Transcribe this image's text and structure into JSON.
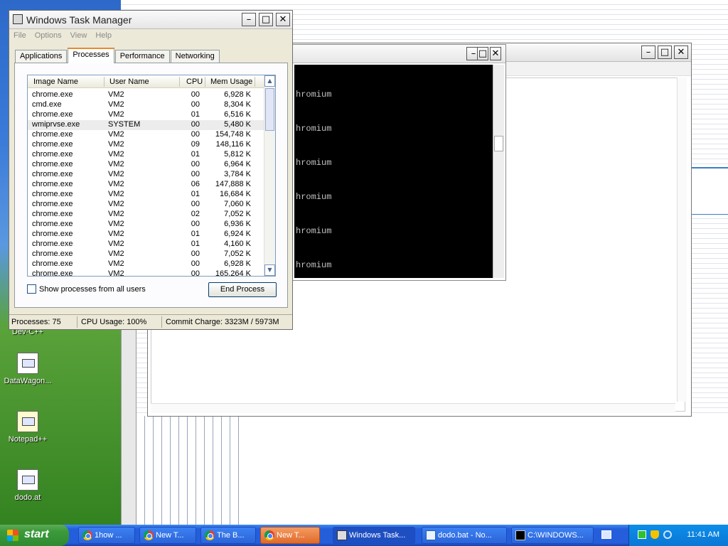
{
  "desktop": {
    "icons": [
      {
        "name": "devcpp",
        "label": "Dev-C++"
      },
      {
        "name": "datawagon",
        "label": "DataWagon..."
      },
      {
        "name": "notepadpp",
        "label": "Notepad++"
      },
      {
        "name": "dodo",
        "label": "dodo.at"
      }
    ]
  },
  "console": {
    "lines": [
      "hromium",
      "hromium",
      "hromium",
      "hromium",
      "hromium",
      "hromium"
    ]
  },
  "task_manager": {
    "title": "Windows Task Manager",
    "menu": [
      "File",
      "Options",
      "View",
      "Help"
    ],
    "tabs": [
      "Applications",
      "Processes",
      "Performance",
      "Networking"
    ],
    "active_tab": "Processes",
    "columns": [
      "Image Name",
      "User Name",
      "CPU",
      "Mem Usage"
    ],
    "rows": [
      {
        "image": "chrome.exe",
        "user": "VM2",
        "cpu": "00",
        "mem": "6,928 K"
      },
      {
        "image": "cmd.exe",
        "user": "VM2",
        "cpu": "00",
        "mem": "8,304 K"
      },
      {
        "image": "chrome.exe",
        "user": "VM2",
        "cpu": "01",
        "mem": "6,516 K"
      },
      {
        "image": "wmiprvse.exe",
        "user": "SYSTEM",
        "cpu": "00",
        "mem": "5,480 K"
      },
      {
        "image": "chrome.exe",
        "user": "VM2",
        "cpu": "00",
        "mem": "154,748 K"
      },
      {
        "image": "chrome.exe",
        "user": "VM2",
        "cpu": "09",
        "mem": "148,116 K"
      },
      {
        "image": "chrome.exe",
        "user": "VM2",
        "cpu": "01",
        "mem": "5,812 K"
      },
      {
        "image": "chrome.exe",
        "user": "VM2",
        "cpu": "00",
        "mem": "6,964 K"
      },
      {
        "image": "chrome.exe",
        "user": "VM2",
        "cpu": "00",
        "mem": "3,784 K"
      },
      {
        "image": "chrome.exe",
        "user": "VM2",
        "cpu": "06",
        "mem": "147,888 K"
      },
      {
        "image": "chrome.exe",
        "user": "VM2",
        "cpu": "01",
        "mem": "16,684 K"
      },
      {
        "image": "chrome.exe",
        "user": "VM2",
        "cpu": "00",
        "mem": "7,060 K"
      },
      {
        "image": "chrome.exe",
        "user": "VM2",
        "cpu": "02",
        "mem": "7,052 K"
      },
      {
        "image": "chrome.exe",
        "user": "VM2",
        "cpu": "00",
        "mem": "6,936 K"
      },
      {
        "image": "chrome.exe",
        "user": "VM2",
        "cpu": "01",
        "mem": "6,924 K"
      },
      {
        "image": "chrome.exe",
        "user": "VM2",
        "cpu": "01",
        "mem": "4,160 K"
      },
      {
        "image": "chrome.exe",
        "user": "VM2",
        "cpu": "00",
        "mem": "7,052 K"
      },
      {
        "image": "chrome.exe",
        "user": "VM2",
        "cpu": "00",
        "mem": "6,928 K"
      },
      {
        "image": "chrome.exe",
        "user": "VM2",
        "cpu": "00",
        "mem": "165,264 K"
      }
    ],
    "selected_index": 3,
    "show_all_label": "Show processes from all users",
    "show_all_checked": false,
    "end_process_label": "End Process",
    "status": {
      "processes": "Processes: 75",
      "cpu": "CPU Usage: 100%",
      "commit": "Commit Charge: 3323M / 5973M"
    }
  },
  "taskbar": {
    "start_label": "start",
    "buttons": [
      {
        "label": "1how ...",
        "icon": "chrome",
        "state": "normal"
      },
      {
        "label": "New T...",
        "icon": "chrome",
        "state": "normal"
      },
      {
        "label": "The B...",
        "icon": "chrome",
        "state": "normal"
      },
      {
        "label": "New T...",
        "icon": "chrome",
        "state": "active"
      },
      {
        "label": "Windows Task...",
        "icon": "task-manager",
        "state": "pressed"
      },
      {
        "label": "dodo.bat - No...",
        "icon": "notepad",
        "state": "normal"
      },
      {
        "label": "C:\\WINDOWS...",
        "icon": "cmd",
        "state": "normal"
      }
    ],
    "clock": "11:41 AM"
  }
}
